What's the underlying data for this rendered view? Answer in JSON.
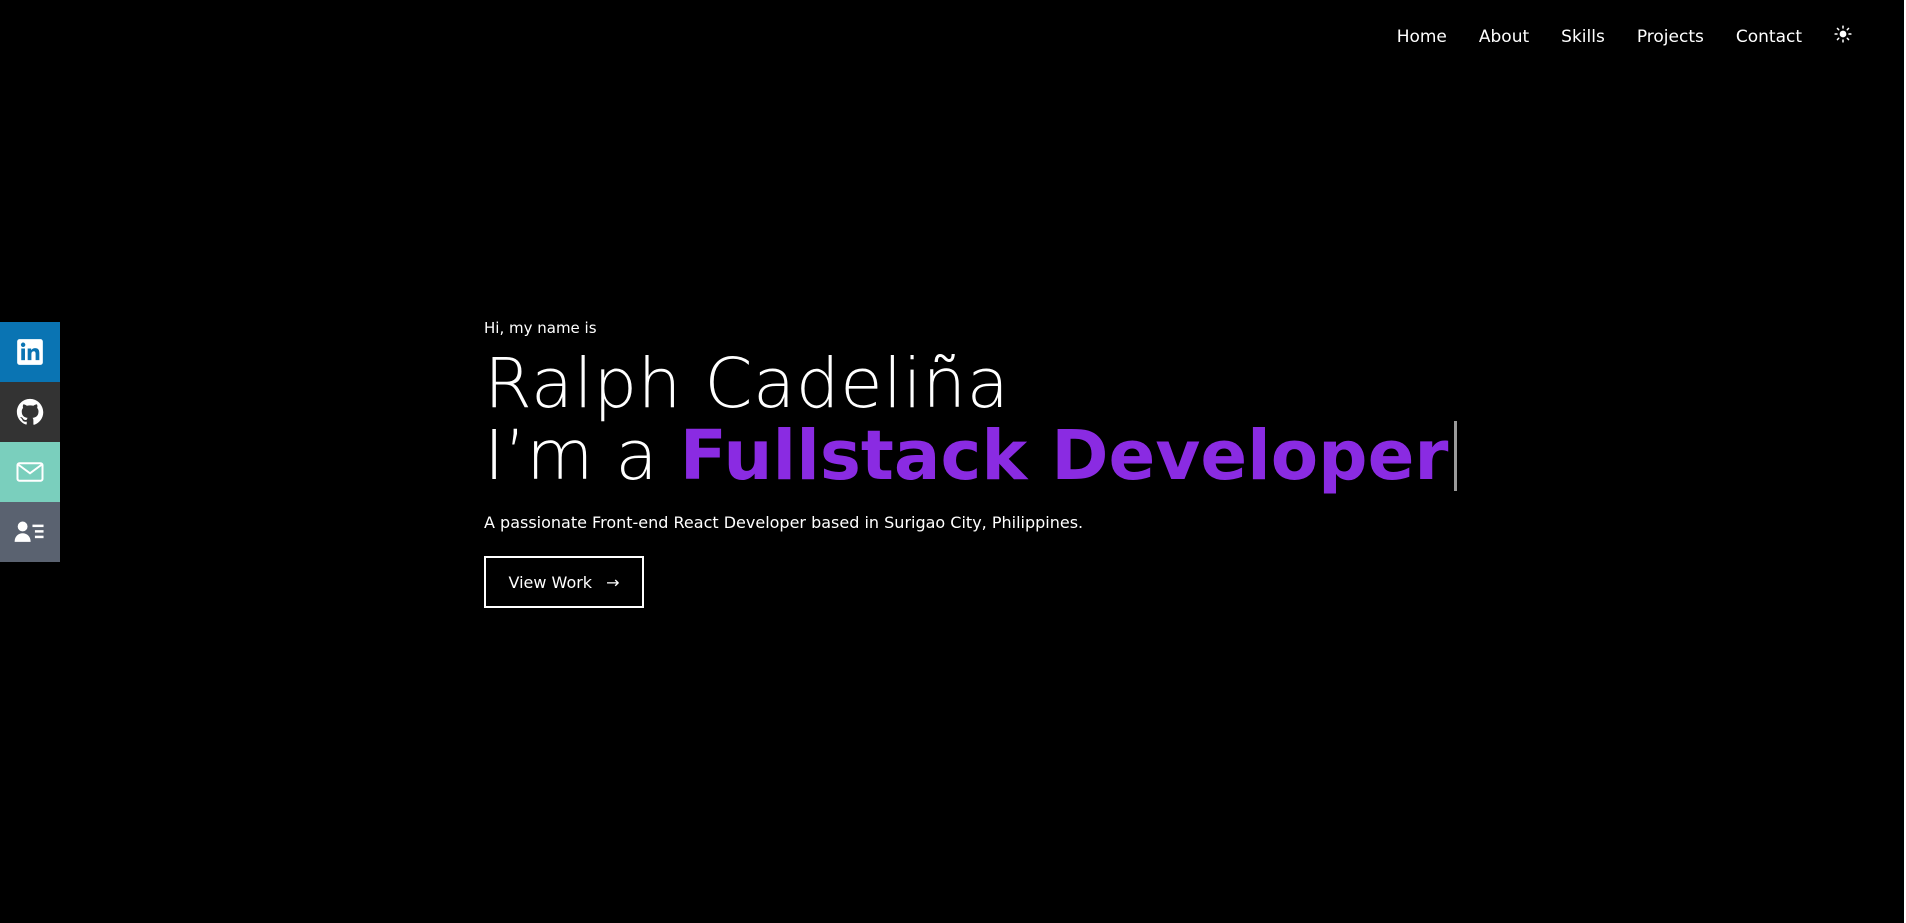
{
  "nav": {
    "items": [
      {
        "label": "Home"
      },
      {
        "label": "About"
      },
      {
        "label": "Skills"
      },
      {
        "label": "Projects"
      },
      {
        "label": "Contact"
      }
    ],
    "theme_icon": "sun-icon"
  },
  "social": {
    "items": [
      {
        "name": "linkedin",
        "icon": "linkedin-icon",
        "color": "#0a74b3"
      },
      {
        "name": "github",
        "icon": "github-icon",
        "color": "#333333"
      },
      {
        "name": "email",
        "icon": "mail-icon",
        "color": "#7acfbd"
      },
      {
        "name": "resume",
        "icon": "contact-card-icon",
        "color": "#5a6270"
      }
    ]
  },
  "hero": {
    "greeting": "Hi, my name is",
    "name": "Ralph Cadeliña",
    "role_prefix": "I’m a",
    "role_highlight": "Fullstack Developer",
    "tagline": "A passionate Front-end React Developer based in Surigao City, Philippines.",
    "cta_label": "View Work",
    "cta_arrow": "→"
  },
  "colors": {
    "background": "#000000",
    "text": "#ffffff",
    "accent": "#8a2be2"
  }
}
